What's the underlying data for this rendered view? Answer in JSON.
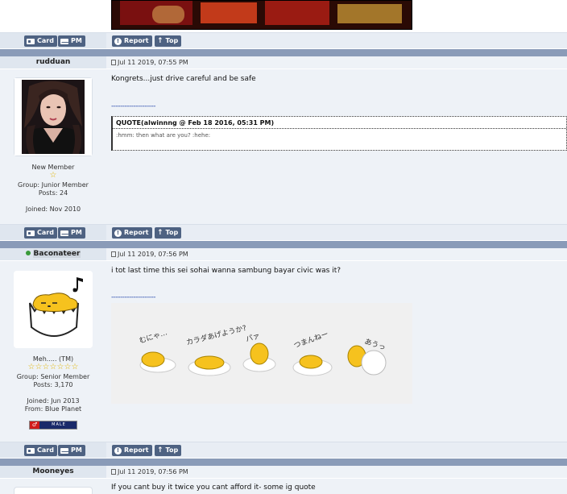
{
  "buttons": {
    "card": "Card",
    "pm": "PM",
    "report": "Report",
    "top": "Top"
  },
  "posts": [
    {
      "username": "rudduan",
      "date": "Jul 11 2019, 07:55 PM",
      "title": "New Member",
      "group": "Group: Junior Member",
      "posts": "Posts: 24",
      "joined": "Joined: Nov 2010",
      "text": "Kongrets...just drive careful and be safe",
      "signature_rule": "--------------------",
      "quote_header": "QUOTE(alwinnng @ Feb 18 2016, 05:31 PM)",
      "quote_body": ":hmm: then what are you? :hehe:"
    },
    {
      "username": "Baconateer",
      "online": true,
      "date": "Jul 11 2019, 07:56 PM",
      "title": "Meh..... (TM)",
      "group": "Group: Senior Member",
      "posts": "Posts: 3,170",
      "joined": "Joined: Jun 2013",
      "from": "From: Blue Planet",
      "gender_badge": "MALE",
      "text": "i tot last time this sei sohai wanna sambung bayar civic was it?",
      "signature_rule": "--------------------",
      "stars": 7,
      "image_captions": [
        "むにゃ…",
        "カラダあげようか?",
        "パァ",
        "つまんねー",
        "あうっ"
      ]
    },
    {
      "username": "Mooneyes",
      "date": "Jul 11 2019, 07:56 PM",
      "text": "If you cant buy it twice you cant afford it- some ig quote"
    }
  ],
  "colors": {
    "button_bg": "#4e6282",
    "separator": "#8a9bb8",
    "row_bg": "#eef2f7",
    "name_cell_bg": "#dfe6ef"
  }
}
